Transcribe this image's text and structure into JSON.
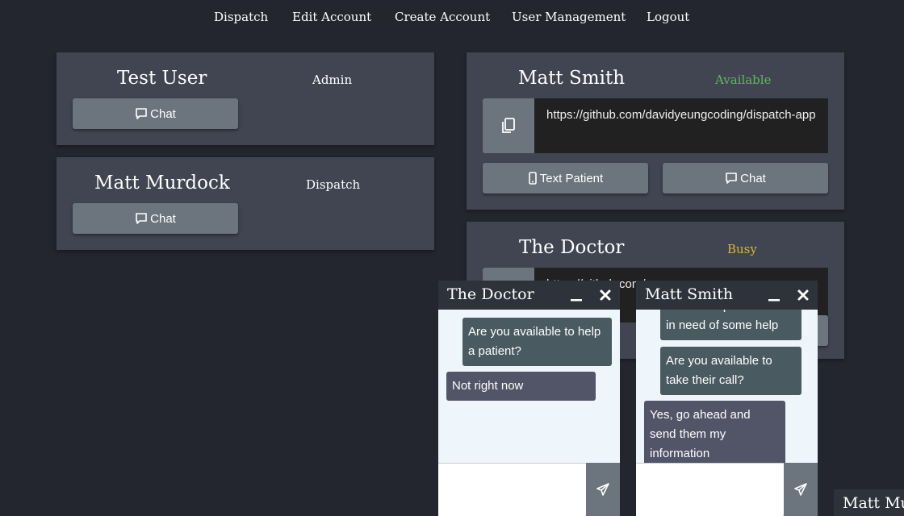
{
  "nav": {
    "items": [
      "Dispatch",
      "Edit Account",
      "Create Account",
      "User Management",
      "Logout"
    ]
  },
  "users": [
    {
      "name": "Test User",
      "role": "Admin",
      "chat_label": "Chat"
    },
    {
      "name": "Matt Murdock",
      "role": "Dispatch",
      "chat_label": "Chat"
    }
  ],
  "providers": [
    {
      "name": "Matt Smith",
      "status": "Available",
      "status_color": "#5cb85c",
      "link": "https://github.com/davidyeungcoding/dispatch-app",
      "text_label": "Text Patient",
      "chat_label": "Chat"
    },
    {
      "name": "The Doctor",
      "status": "Busy",
      "status_color": "#d9b53b",
      "link": "https://github.com/..."
    }
  ],
  "chats": [
    {
      "title": "The Doctor",
      "messages": [
        {
          "from": "me",
          "text": "Are you available to help a patient?"
        },
        {
          "from": "them",
          "text": "Not right now"
        }
      ]
    },
    {
      "title": "Matt Smith",
      "messages": [
        {
          "from": "me",
          "text": "There is a patient that is in need of some help"
        },
        {
          "from": "me",
          "text": "Are you available to take their call?"
        },
        {
          "from": "them",
          "text": "Yes, go ahead and send them my information"
        }
      ]
    }
  ],
  "minimized_chat": {
    "title": "Matt Murdock"
  }
}
